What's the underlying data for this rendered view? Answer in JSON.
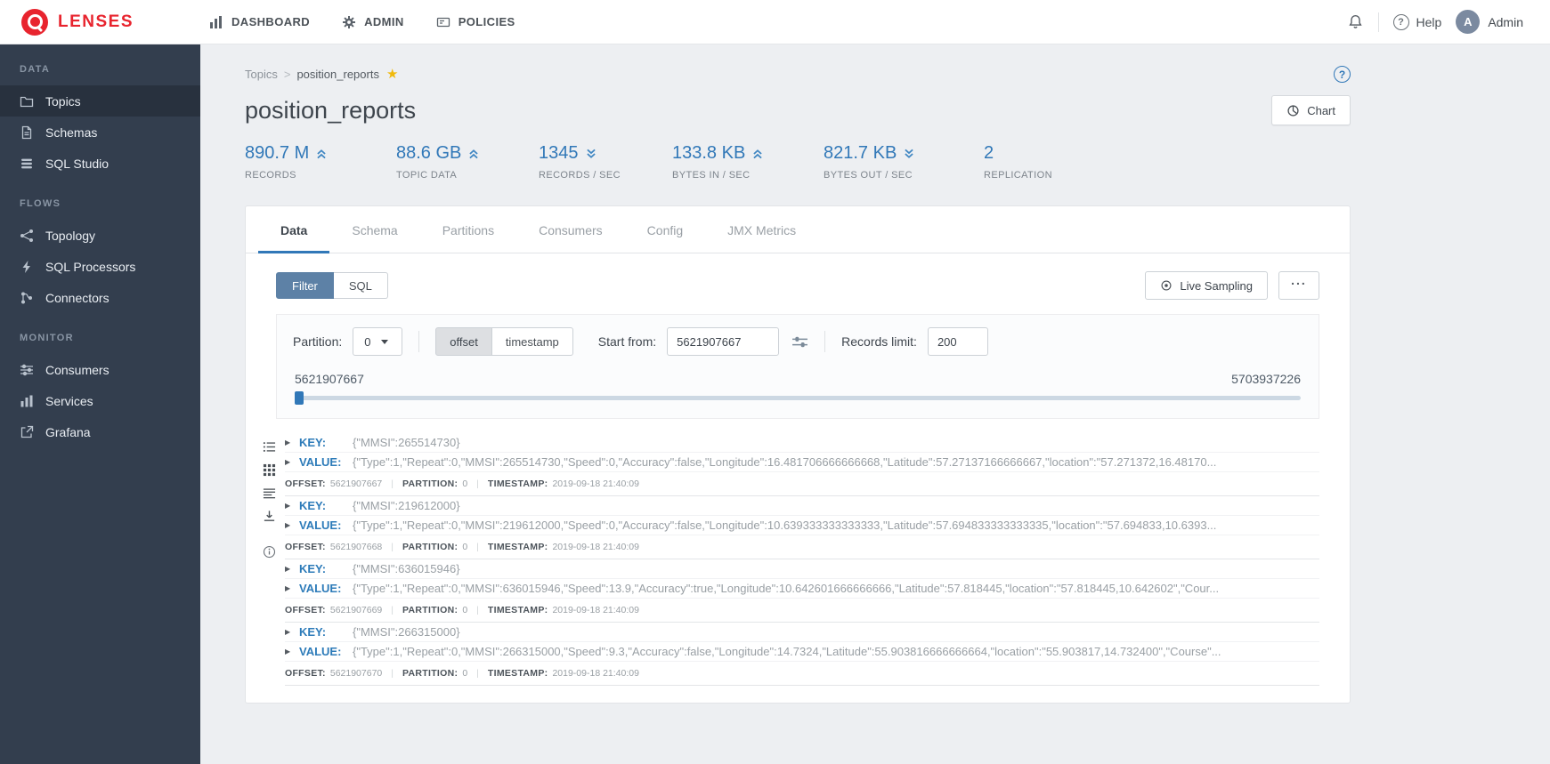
{
  "brand": {
    "name": "LENSES"
  },
  "navbar": {
    "items": [
      {
        "label": "DASHBOARD",
        "icon": "bar-chart-icon"
      },
      {
        "label": "ADMIN",
        "icon": "gear-icon"
      },
      {
        "label": "POLICIES",
        "icon": "policies-icon"
      }
    ],
    "help_label": "Help",
    "user": {
      "initial": "A",
      "name": "Admin"
    }
  },
  "sidebar": {
    "sections": [
      {
        "title": "DATA",
        "items": [
          {
            "label": "Topics",
            "icon": "folder-icon",
            "active": true
          },
          {
            "label": "Schemas",
            "icon": "document-icon",
            "active": false
          },
          {
            "label": "SQL Studio",
            "icon": "database-icon",
            "active": false
          }
        ]
      },
      {
        "title": "FLOWS",
        "items": [
          {
            "label": "Topology",
            "icon": "share-icon",
            "active": false
          },
          {
            "label": "SQL Processors",
            "icon": "bolt-icon",
            "active": false
          },
          {
            "label": "Connectors",
            "icon": "plug-icon",
            "active": false
          }
        ]
      },
      {
        "title": "MONITOR",
        "items": [
          {
            "label": "Consumers",
            "icon": "sliders-icon",
            "active": false
          },
          {
            "label": "Services",
            "icon": "bar-chart-icon",
            "active": false
          },
          {
            "label": "Grafana",
            "icon": "external-link-icon",
            "active": false
          }
        ]
      }
    ]
  },
  "breadcrumb": {
    "root": "Topics",
    "sep": ">",
    "current": "position_reports"
  },
  "page": {
    "title": "position_reports",
    "chart_button": "Chart"
  },
  "icons": {
    "question_mark": "?",
    "star": "★",
    "record_arrow": "▶",
    "pipe": "|",
    "more": "..."
  },
  "stats": [
    {
      "value": "890.7 M",
      "label": "RECORDS",
      "trend": "up"
    },
    {
      "value": "88.6 GB",
      "label": "TOPIC DATA",
      "trend": "up"
    },
    {
      "value": "1345",
      "label": "RECORDS / SEC",
      "trend": "down"
    },
    {
      "value": "133.8 KB",
      "label": "BYTES IN / SEC",
      "trend": "up"
    },
    {
      "value": "821.7 KB",
      "label": "BYTES OUT / SEC",
      "trend": "down"
    },
    {
      "value": "2",
      "label": "REPLICATION",
      "trend": "none"
    }
  ],
  "tabs": [
    {
      "label": "Data",
      "active": true
    },
    {
      "label": "Schema",
      "active": false
    },
    {
      "label": "Partitions",
      "active": false
    },
    {
      "label": "Consumers",
      "active": false
    },
    {
      "label": "Config",
      "active": false
    },
    {
      "label": "JMX Metrics",
      "active": false
    }
  ],
  "toolbar": {
    "filter_label": "Filter",
    "sql_label": "SQL",
    "live_sampling_label": "Live Sampling"
  },
  "filters": {
    "partition_label": "Partition:",
    "partition_value": "0",
    "mode_offset": "offset",
    "mode_timestamp": "timestamp",
    "start_from_label": "Start from:",
    "start_from_value": "5621907667",
    "records_limit_label": "Records limit:",
    "records_limit_value": "200"
  },
  "slider": {
    "min": "5621907667",
    "max": "5703937226"
  },
  "record_labels": {
    "key": "KEY:",
    "value": "VALUE:",
    "offset": "OFFSET:",
    "partition": "PARTITION:",
    "timestamp": "TIMESTAMP:"
  },
  "records": [
    {
      "key": "{\"MMSI\":265514730}",
      "value": "{\"Type\":1,\"Repeat\":0,\"MMSI\":265514730,\"Speed\":0,\"Accuracy\":false,\"Longitude\":16.481706666666668,\"Latitude\":57.27137166666667,\"location\":\"57.271372,16.48170...",
      "offset": "5621907667",
      "partition": "0",
      "timestamp": "2019-09-18 21:40:09"
    },
    {
      "key": "{\"MMSI\":219612000}",
      "value": "{\"Type\":1,\"Repeat\":0,\"MMSI\":219612000,\"Speed\":0,\"Accuracy\":false,\"Longitude\":10.639333333333333,\"Latitude\":57.694833333333335,\"location\":\"57.694833,10.6393...",
      "offset": "5621907668",
      "partition": "0",
      "timestamp": "2019-09-18 21:40:09"
    },
    {
      "key": "{\"MMSI\":636015946}",
      "value": "{\"Type\":1,\"Repeat\":0,\"MMSI\":636015946,\"Speed\":13.9,\"Accuracy\":true,\"Longitude\":10.642601666666666,\"Latitude\":57.818445,\"location\":\"57.818445,10.642602\",\"Cour...",
      "offset": "5621907669",
      "partition": "0",
      "timestamp": "2019-09-18 21:40:09"
    },
    {
      "key": "{\"MMSI\":266315000}",
      "value": "{\"Type\":1,\"Repeat\":0,\"MMSI\":266315000,\"Speed\":9.3,\"Accuracy\":false,\"Longitude\":14.7324,\"Latitude\":55.903816666666664,\"location\":\"55.903817,14.732400\",\"Course\"...",
      "offset": "5621907670",
      "partition": "0",
      "timestamp": "2019-09-18 21:40:09"
    }
  ]
}
